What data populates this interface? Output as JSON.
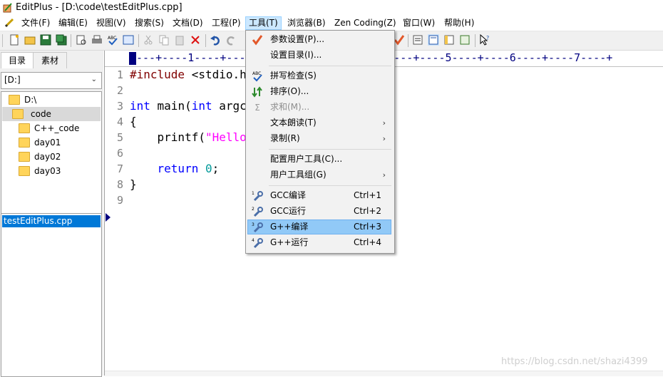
{
  "window": {
    "title": "EditPlus - [D:\\code\\testEditPlus.cpp]"
  },
  "menubar": [
    {
      "label": "文件(F)"
    },
    {
      "label": "编辑(E)"
    },
    {
      "label": "视图(V)"
    },
    {
      "label": "搜索(S)"
    },
    {
      "label": "文档(D)"
    },
    {
      "label": "工程(P)"
    },
    {
      "label": "工具(T)"
    },
    {
      "label": "浏览器(B)"
    },
    {
      "label": "Zen Coding(Z)"
    },
    {
      "label": "窗口(W)"
    },
    {
      "label": "帮助(H)"
    }
  ],
  "left_panel": {
    "tabs": [
      {
        "label": "目录"
      },
      {
        "label": "素材"
      }
    ],
    "drive": "[D:]",
    "tree": [
      {
        "label": "D:\\"
      },
      {
        "label": "code"
      },
      {
        "label": "C++_code"
      },
      {
        "label": "day01"
      },
      {
        "label": "day02"
      },
      {
        "label": "day03"
      }
    ],
    "files": [
      {
        "label": "testEditPlus.cpp"
      }
    ]
  },
  "editor": {
    "ruler": "---+----1----+----2----+----3----+----4----+----5----+----6----+----7----+",
    "line_numbers": [
      "1",
      "2",
      "3",
      "4",
      "5",
      "6",
      "7",
      "8",
      "9"
    ],
    "code": {
      "l1_directive": "#include",
      "l1_rest": " <stdio.h>",
      "l3_kw1": "int",
      "l3_mid": " main(",
      "l3_kw2": "int",
      "l3_rest": " argc",
      "l4": "{",
      "l5_pre": "    printf(",
      "l5_str": "\"Hello",
      "l7_kw": "    return",
      "l7_sp": " ",
      "l7_num": "0",
      "l7_end": ";",
      "l8": "}"
    }
  },
  "tools_menu": {
    "items": [
      {
        "label": "参数设置(P)..."
      },
      {
        "label": "设置目录(I)..."
      },
      {
        "label": "拼写检查(S)"
      },
      {
        "label": "排序(O)..."
      },
      {
        "label": "求和(M)..."
      },
      {
        "label": "文本朗读(T)"
      },
      {
        "label": "录制(R)"
      },
      {
        "label": "配置用户工具(C)..."
      },
      {
        "label": "用户工具组(G)"
      },
      {
        "label": "GCC编译",
        "shortcut": "Ctrl+1"
      },
      {
        "label": "GCC运行",
        "shortcut": "Ctrl+2"
      },
      {
        "label": "G++编译",
        "shortcut": "Ctrl+3"
      },
      {
        "label": "G++运行",
        "shortcut": "Ctrl+4"
      }
    ],
    "tool_numbers": [
      "1",
      "2",
      "3",
      "4"
    ]
  },
  "watermark": "https://blog.csdn.net/shazi4399"
}
